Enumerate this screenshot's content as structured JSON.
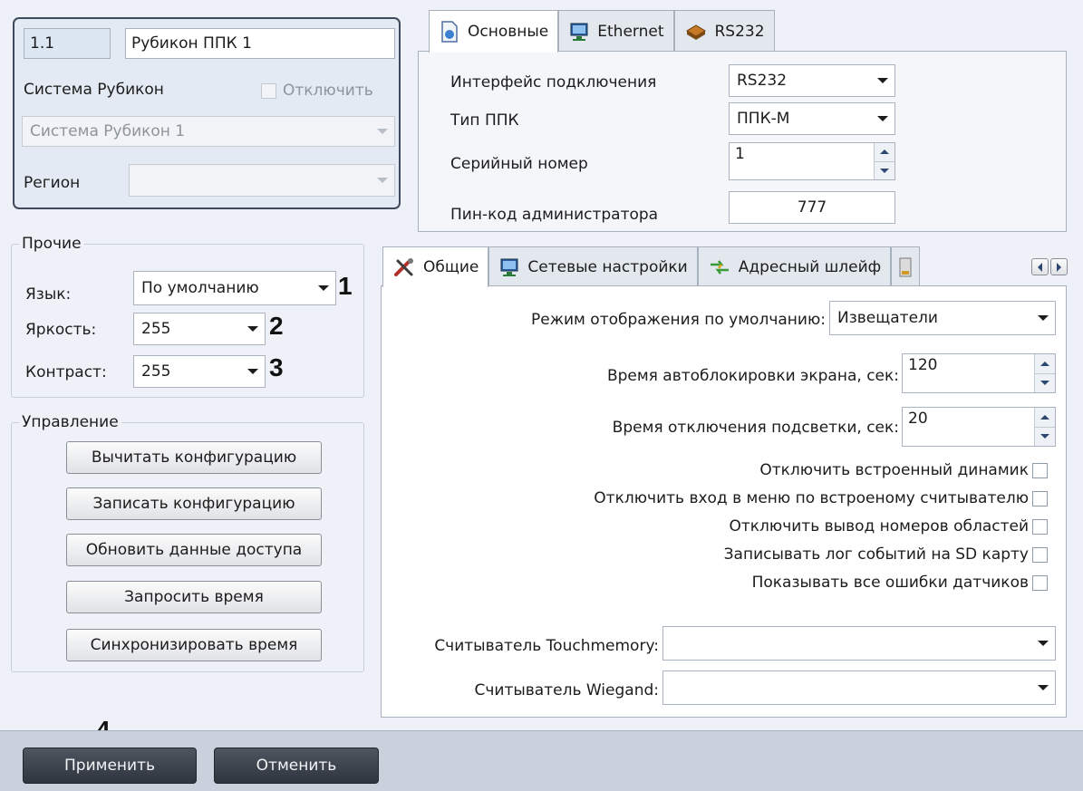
{
  "top_left": {
    "id_value": "1.1",
    "name_value": "Рубикон ППК 1",
    "system_label": "Система Рубикон",
    "disable_label": "Отключить",
    "system_value": "Система Рубикон 1",
    "region_label": "Регион",
    "region_value": ""
  },
  "top_tabs": [
    {
      "label": "Основные",
      "icon": "document-icon"
    },
    {
      "label": "Ethernet",
      "icon": "network-icon"
    },
    {
      "label": "RS232",
      "icon": "chip-icon"
    }
  ],
  "main_settings": {
    "interface_label": "Интерфейс подключения",
    "interface_value": "RS232",
    "type_label": "Тип ППК",
    "type_value": "ППК-М",
    "serial_label": "Серийный номер",
    "serial_value": "1",
    "pin_label": "Пин-код администратора",
    "pin_value": "777"
  },
  "other": {
    "legend": "Прочие",
    "language_label": "Язык:",
    "language_value": "По умолчанию",
    "brightness_label": "Яркость:",
    "brightness_value": "255",
    "contrast_label": "Контраст:",
    "contrast_value": "255"
  },
  "control": {
    "legend": "Управление",
    "buttons": [
      "Вычитать конфигурацию",
      "Записать конфигурацию",
      "Обновить данные доступа",
      "Запросить время",
      "Синхронизировать время"
    ]
  },
  "bottom_tabs": [
    {
      "label": "Общие",
      "icon": "tools-icon"
    },
    {
      "label": "Сетевые настройки",
      "icon": "network-icon"
    },
    {
      "label": "Адресный шлейф",
      "icon": "arrows-icon"
    }
  ],
  "general": {
    "display_mode_label": "Режим отображения по умолчанию:",
    "display_mode_value": "Извещатели",
    "autolock_label": "Время автоблокировки экрана, сек:",
    "autolock_value": "120",
    "backlight_label": "Время отключения подсветки, сек:",
    "backlight_value": "20",
    "checkboxes": [
      "Отключить встроенный динамик",
      "Отключить вход в меню по встроеному считывателю",
      "Отключить вывод номеров областей",
      "Записывать лог событий на SD карту",
      "Показывать все ошибки датчиков"
    ],
    "touchmemory_label": "Считыватель Touchmemory:",
    "touchmemory_value": "",
    "wiegand_label": "Считыватель Wiegand:",
    "wiegand_value": ""
  },
  "footer": {
    "apply_label": "Применить",
    "cancel_label": "Отменить"
  },
  "annotations": [
    "1",
    "2",
    "3",
    "4"
  ]
}
